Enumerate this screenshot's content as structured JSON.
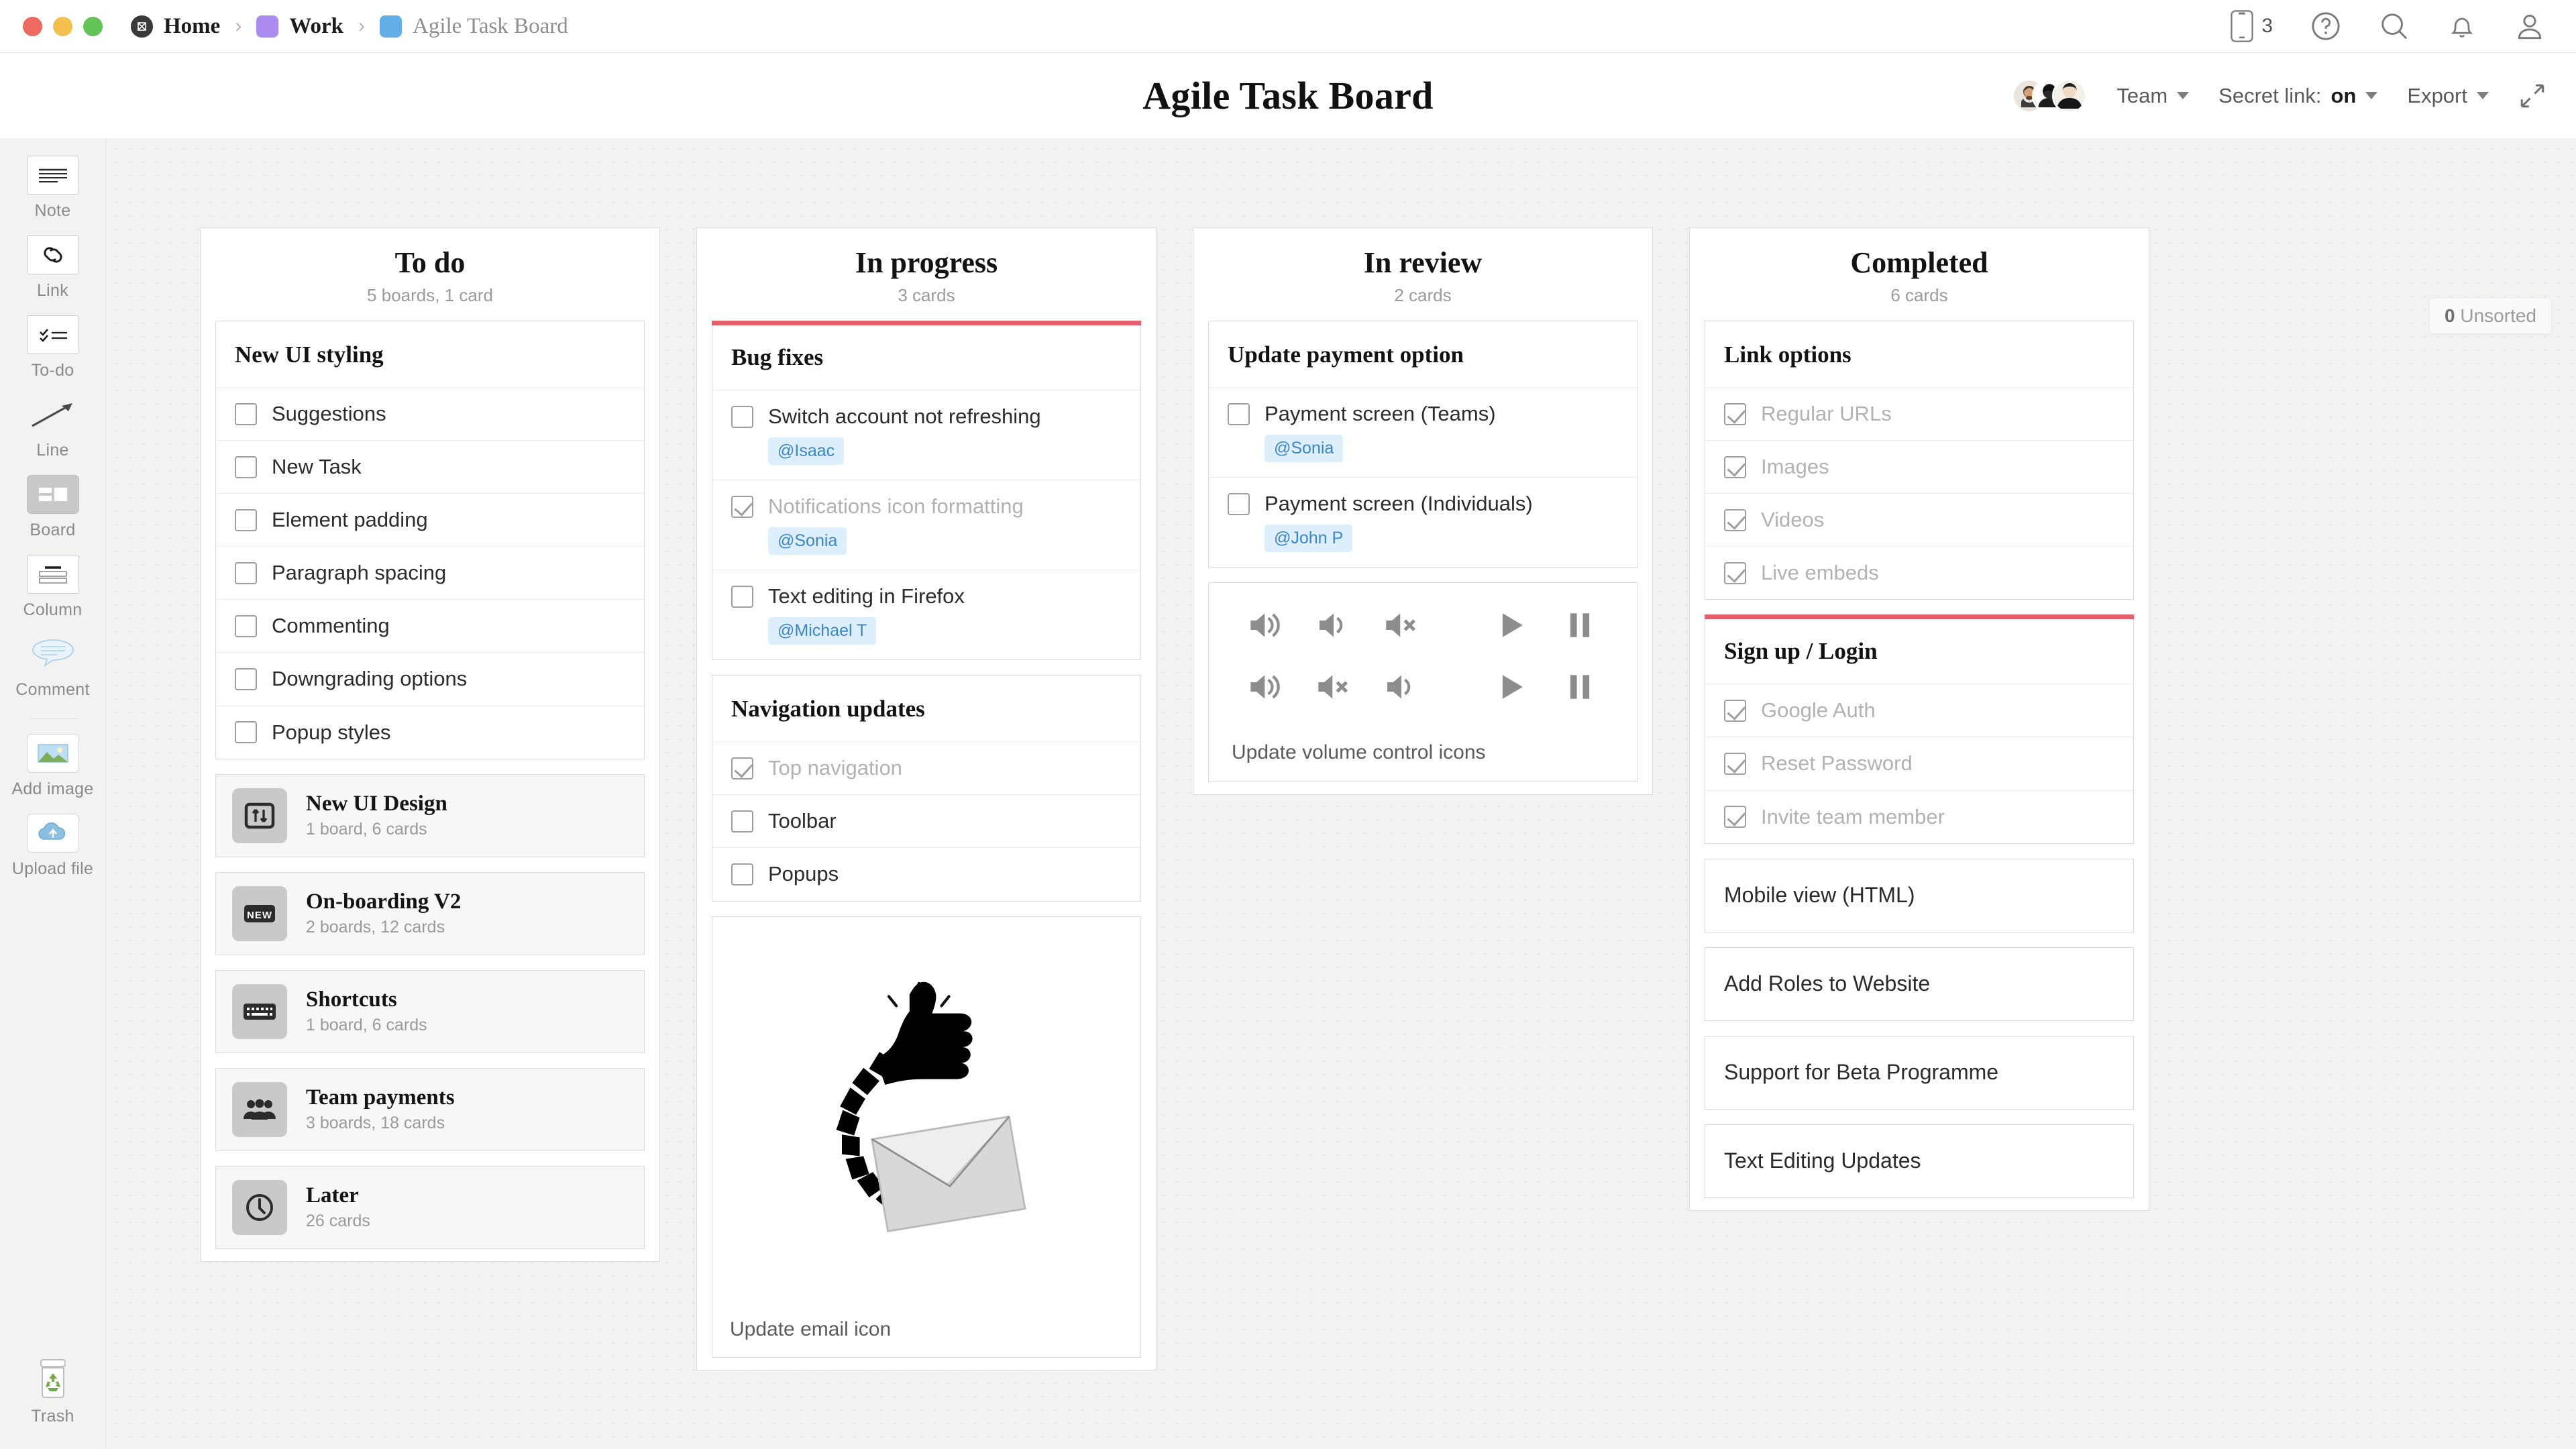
{
  "window": {
    "traffic_lights": [
      "close",
      "minimize",
      "zoom"
    ]
  },
  "breadcrumb": [
    {
      "label": "Home",
      "icon": "milanote-logo-icon",
      "muted": false
    },
    {
      "label": "Work",
      "icon": "purple-square-icon",
      "muted": false
    },
    {
      "label": "Agile Task Board",
      "icon": "blue-square-icon",
      "muted": true
    }
  ],
  "breadcrumb_separator": "›",
  "topbar": {
    "mobile_count": "3",
    "icons": [
      "mobile-icon",
      "help-icon",
      "search-icon",
      "notifications-icon",
      "account-icon"
    ]
  },
  "header": {
    "title": "Agile Task Board",
    "team_label": "Team",
    "secret_link_label": "Secret link:",
    "secret_link_value": "on",
    "export_label": "Export",
    "fullscreen_icon": "expand-icon"
  },
  "sidebar": {
    "items": [
      {
        "label": "Note",
        "icon": "note-icon",
        "selected": false
      },
      {
        "label": "Link",
        "icon": "link-icon",
        "selected": false
      },
      {
        "label": "To-do",
        "icon": "todo-icon",
        "selected": false
      },
      {
        "label": "Line",
        "icon": "line-arrow-icon",
        "selected": false
      },
      {
        "label": "Board",
        "icon": "board-icon",
        "selected": true
      },
      {
        "label": "Column",
        "icon": "column-icon",
        "selected": false
      },
      {
        "label": "Comment",
        "icon": "comment-icon",
        "selected": false
      },
      {
        "label": "Add image",
        "icon": "image-icon",
        "selected": false
      },
      {
        "label": "Upload file",
        "icon": "upload-cloud-icon",
        "selected": false
      }
    ],
    "trash": {
      "label": "Trash",
      "icon": "trash-recycle-icon"
    }
  },
  "canvas": {
    "unsorted_count": "0",
    "unsorted_label": "Unsorted"
  },
  "columns": [
    {
      "title": "To do",
      "meta": "5 boards, 1 card",
      "accent": false,
      "cards": [
        {
          "type": "checklist",
          "title": "New UI styling",
          "accent": false,
          "items": [
            {
              "text": "Suggestions",
              "done": false,
              "mention": null
            },
            {
              "text": "New Task",
              "done": false,
              "mention": null
            },
            {
              "text": "Element padding",
              "done": false,
              "mention": null
            },
            {
              "text": "Paragraph spacing",
              "done": false,
              "mention": null
            },
            {
              "text": "Commenting",
              "done": false,
              "mention": null
            },
            {
              "text": "Downgrading options",
              "done": false,
              "mention": null
            },
            {
              "text": "Popup styles",
              "done": false,
              "mention": null
            }
          ]
        },
        {
          "type": "board",
          "name": "New UI Design",
          "meta": "1 board, 6 cards",
          "icon": "sliders-icon"
        },
        {
          "type": "board",
          "name": "On-boarding V2",
          "meta": "2 boards, 12 cards",
          "icon": "new-badge-icon"
        },
        {
          "type": "board",
          "name": "Shortcuts",
          "meta": "1 board, 6 cards",
          "icon": "keyboard-icon"
        },
        {
          "type": "board",
          "name": "Team payments",
          "meta": "3 boards, 18 cards",
          "icon": "people-icon"
        },
        {
          "type": "board",
          "name": "Later",
          "meta": "26 cards",
          "icon": "clock-icon"
        }
      ]
    },
    {
      "title": "In progress",
      "meta": "3 cards",
      "accent": false,
      "cards": [
        {
          "type": "checklist",
          "title": "Bug fixes",
          "accent": true,
          "items": [
            {
              "text": "Switch account not refreshing",
              "done": false,
              "mention": "@Isaac"
            },
            {
              "text": "Notifications icon formatting",
              "done": true,
              "mention": "@Sonia"
            },
            {
              "text": "Text editing in Firefox",
              "done": false,
              "mention": "@Michael T"
            }
          ]
        },
        {
          "type": "checklist",
          "title": "Navigation updates",
          "accent": false,
          "items": [
            {
              "text": "Top navigation",
              "done": true,
              "mention": null
            },
            {
              "text": "Toolbar",
              "done": false,
              "mention": null
            },
            {
              "text": "Popups",
              "done": false,
              "mention": null
            }
          ]
        },
        {
          "type": "image",
          "caption": "Update email icon",
          "image": "thumbs-up-envelope-illustration"
        }
      ]
    },
    {
      "title": "In review",
      "meta": "2 cards",
      "accent": false,
      "cards": [
        {
          "type": "checklist",
          "title": "Update payment option",
          "accent": false,
          "items": [
            {
              "text": "Payment screen (Teams)",
              "done": false,
              "mention": "@Sonia"
            },
            {
              "text": "Payment screen (Individuals)",
              "done": false,
              "mention": "@John P"
            }
          ]
        },
        {
          "type": "icons",
          "caption": "Update volume control icons",
          "rows": [
            [
              "volume-high-icon",
              "volume-low-icon",
              "volume-mute-icon",
              "play-icon",
              "pause-icon"
            ],
            [
              "volume-high-icon",
              "volume-mute-icon",
              "volume-low-icon",
              "play-icon",
              "pause-icon"
            ]
          ]
        }
      ]
    },
    {
      "title": "Completed",
      "meta": "6 cards",
      "accent": false,
      "cards": [
        {
          "type": "checklist",
          "title": "Link options",
          "accent": false,
          "items": [
            {
              "text": "Regular URLs",
              "done": true,
              "mention": null
            },
            {
              "text": "Images",
              "done": true,
              "mention": null
            },
            {
              "text": "Videos",
              "done": true,
              "mention": null
            },
            {
              "text": "Live embeds",
              "done": true,
              "mention": null
            }
          ]
        },
        {
          "type": "checklist",
          "title": "Sign up / Login",
          "accent": true,
          "items": [
            {
              "text": "Google Auth",
              "done": true,
              "mention": null
            },
            {
              "text": "Reset Password",
              "done": true,
              "mention": null
            },
            {
              "text": "Invite team member",
              "done": true,
              "mention": null
            }
          ]
        },
        {
          "type": "simple",
          "title": "Mobile view (HTML)"
        },
        {
          "type": "simple",
          "title": "Add Roles to Website"
        },
        {
          "type": "simple",
          "title": "Support for Beta Programme"
        },
        {
          "type": "simple",
          "title": "Text Editing Updates"
        }
      ]
    }
  ],
  "colors": {
    "accent_red": "#e4606d",
    "mention_bg": "#ddeefc",
    "mention_text": "#3b86c9",
    "canvas_bg": "#f2f2f1",
    "purple_badge": "#ab8bef",
    "blue_badge": "#63aee6"
  }
}
